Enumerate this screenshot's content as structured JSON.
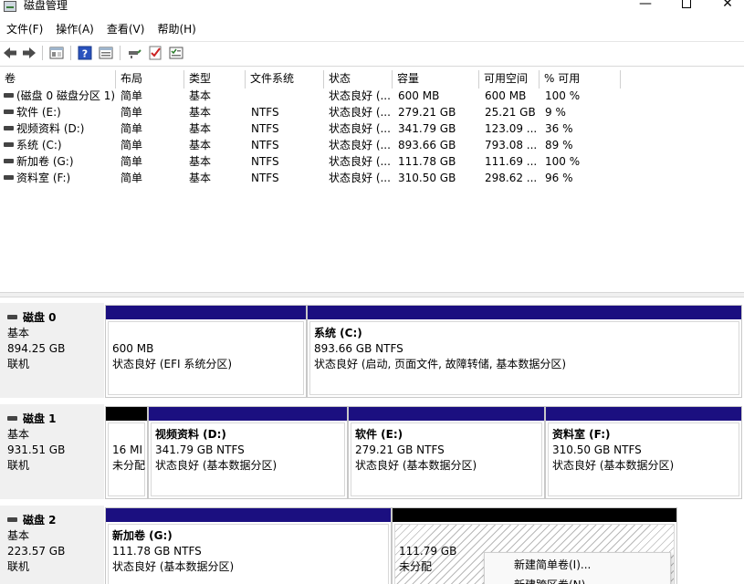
{
  "window": {
    "title": "磁盘管理",
    "minimize": "—",
    "close": "✕"
  },
  "menu": [
    "文件(F)",
    "操作(A)",
    "查看(V)",
    "帮助(H)"
  ],
  "toolbar": {
    "icons": [
      "back-arrow-icon",
      "forward-arrow-icon",
      "console-tree-icon",
      "help-icon",
      "properties-icon",
      "connect-disk-icon",
      "checklist-icon",
      "view-settings-icon"
    ]
  },
  "volume_list": {
    "headers": [
      "卷",
      "布局",
      "类型",
      "文件系统",
      "状态",
      "容量",
      "可用空间",
      "% 可用"
    ],
    "rows": [
      [
        "(磁盘 0 磁盘分区 1)",
        "简单",
        "基本",
        "",
        "状态良好 (...",
        "600 MB",
        "600 MB",
        "100 %"
      ],
      [
        "软件 (E:)",
        "简单",
        "基本",
        "NTFS",
        "状态良好 (...",
        "279.21 GB",
        "25.21 GB",
        "9 %"
      ],
      [
        "视频资料 (D:)",
        "简单",
        "基本",
        "NTFS",
        "状态良好 (...",
        "341.79 GB",
        "123.09 ...",
        "36 %"
      ],
      [
        "系统 (C:)",
        "简单",
        "基本",
        "NTFS",
        "状态良好 (...",
        "893.66 GB",
        "793.08 ...",
        "89 %"
      ],
      [
        "新加卷 (G:)",
        "简单",
        "基本",
        "NTFS",
        "状态良好 (...",
        "111.78 GB",
        "111.69 ...",
        "100 %"
      ],
      [
        "资料室 (F:)",
        "简单",
        "基本",
        "NTFS",
        "状态良好 (...",
        "310.50 GB",
        "298.62 ...",
        "96 %"
      ]
    ]
  },
  "disks": [
    {
      "name": "磁盘 0",
      "type": "基本",
      "size": "894.25 GB",
      "status": "联机",
      "partitions": [
        {
          "title": "",
          "size": "600 MB",
          "status": "状态良好 (EFI 系统分区)"
        },
        {
          "title": "系统  (C:)",
          "size": "893.66 GB NTFS",
          "status": "状态良好 (启动, 页面文件, 故障转储, 基本数据分区)"
        }
      ]
    },
    {
      "name": "磁盘 1",
      "type": "基本",
      "size": "931.51 GB",
      "status": "联机",
      "partitions": [
        {
          "title": "",
          "size": "16 MI",
          "status": "未分配"
        },
        {
          "title": "视频资料  (D:)",
          "size": "341.79 GB NTFS",
          "status": "状态良好 (基本数据分区)"
        },
        {
          "title": "软件  (E:)",
          "size": "279.21 GB NTFS",
          "status": "状态良好 (基本数据分区)"
        },
        {
          "title": "资料室  (F:)",
          "size": "310.50 GB NTFS",
          "status": "状态良好 (基本数据分区)"
        }
      ]
    },
    {
      "name": "磁盘 2",
      "type": "基本",
      "size": "223.57 GB",
      "status": "联机",
      "partitions": [
        {
          "title": "新加卷  (G:)",
          "size": "111.78 GB NTFS",
          "status": "状态良好 (基本数据分区)"
        },
        {
          "title": "",
          "size": "111.79 GB",
          "status": "未分配"
        }
      ]
    }
  ],
  "context_menu": {
    "items": [
      "新建简单卷(I)...",
      "新建跨区卷(N)..."
    ]
  },
  "colors": {
    "primary_partition": "#1b0f80",
    "unallocated": "#000000"
  }
}
